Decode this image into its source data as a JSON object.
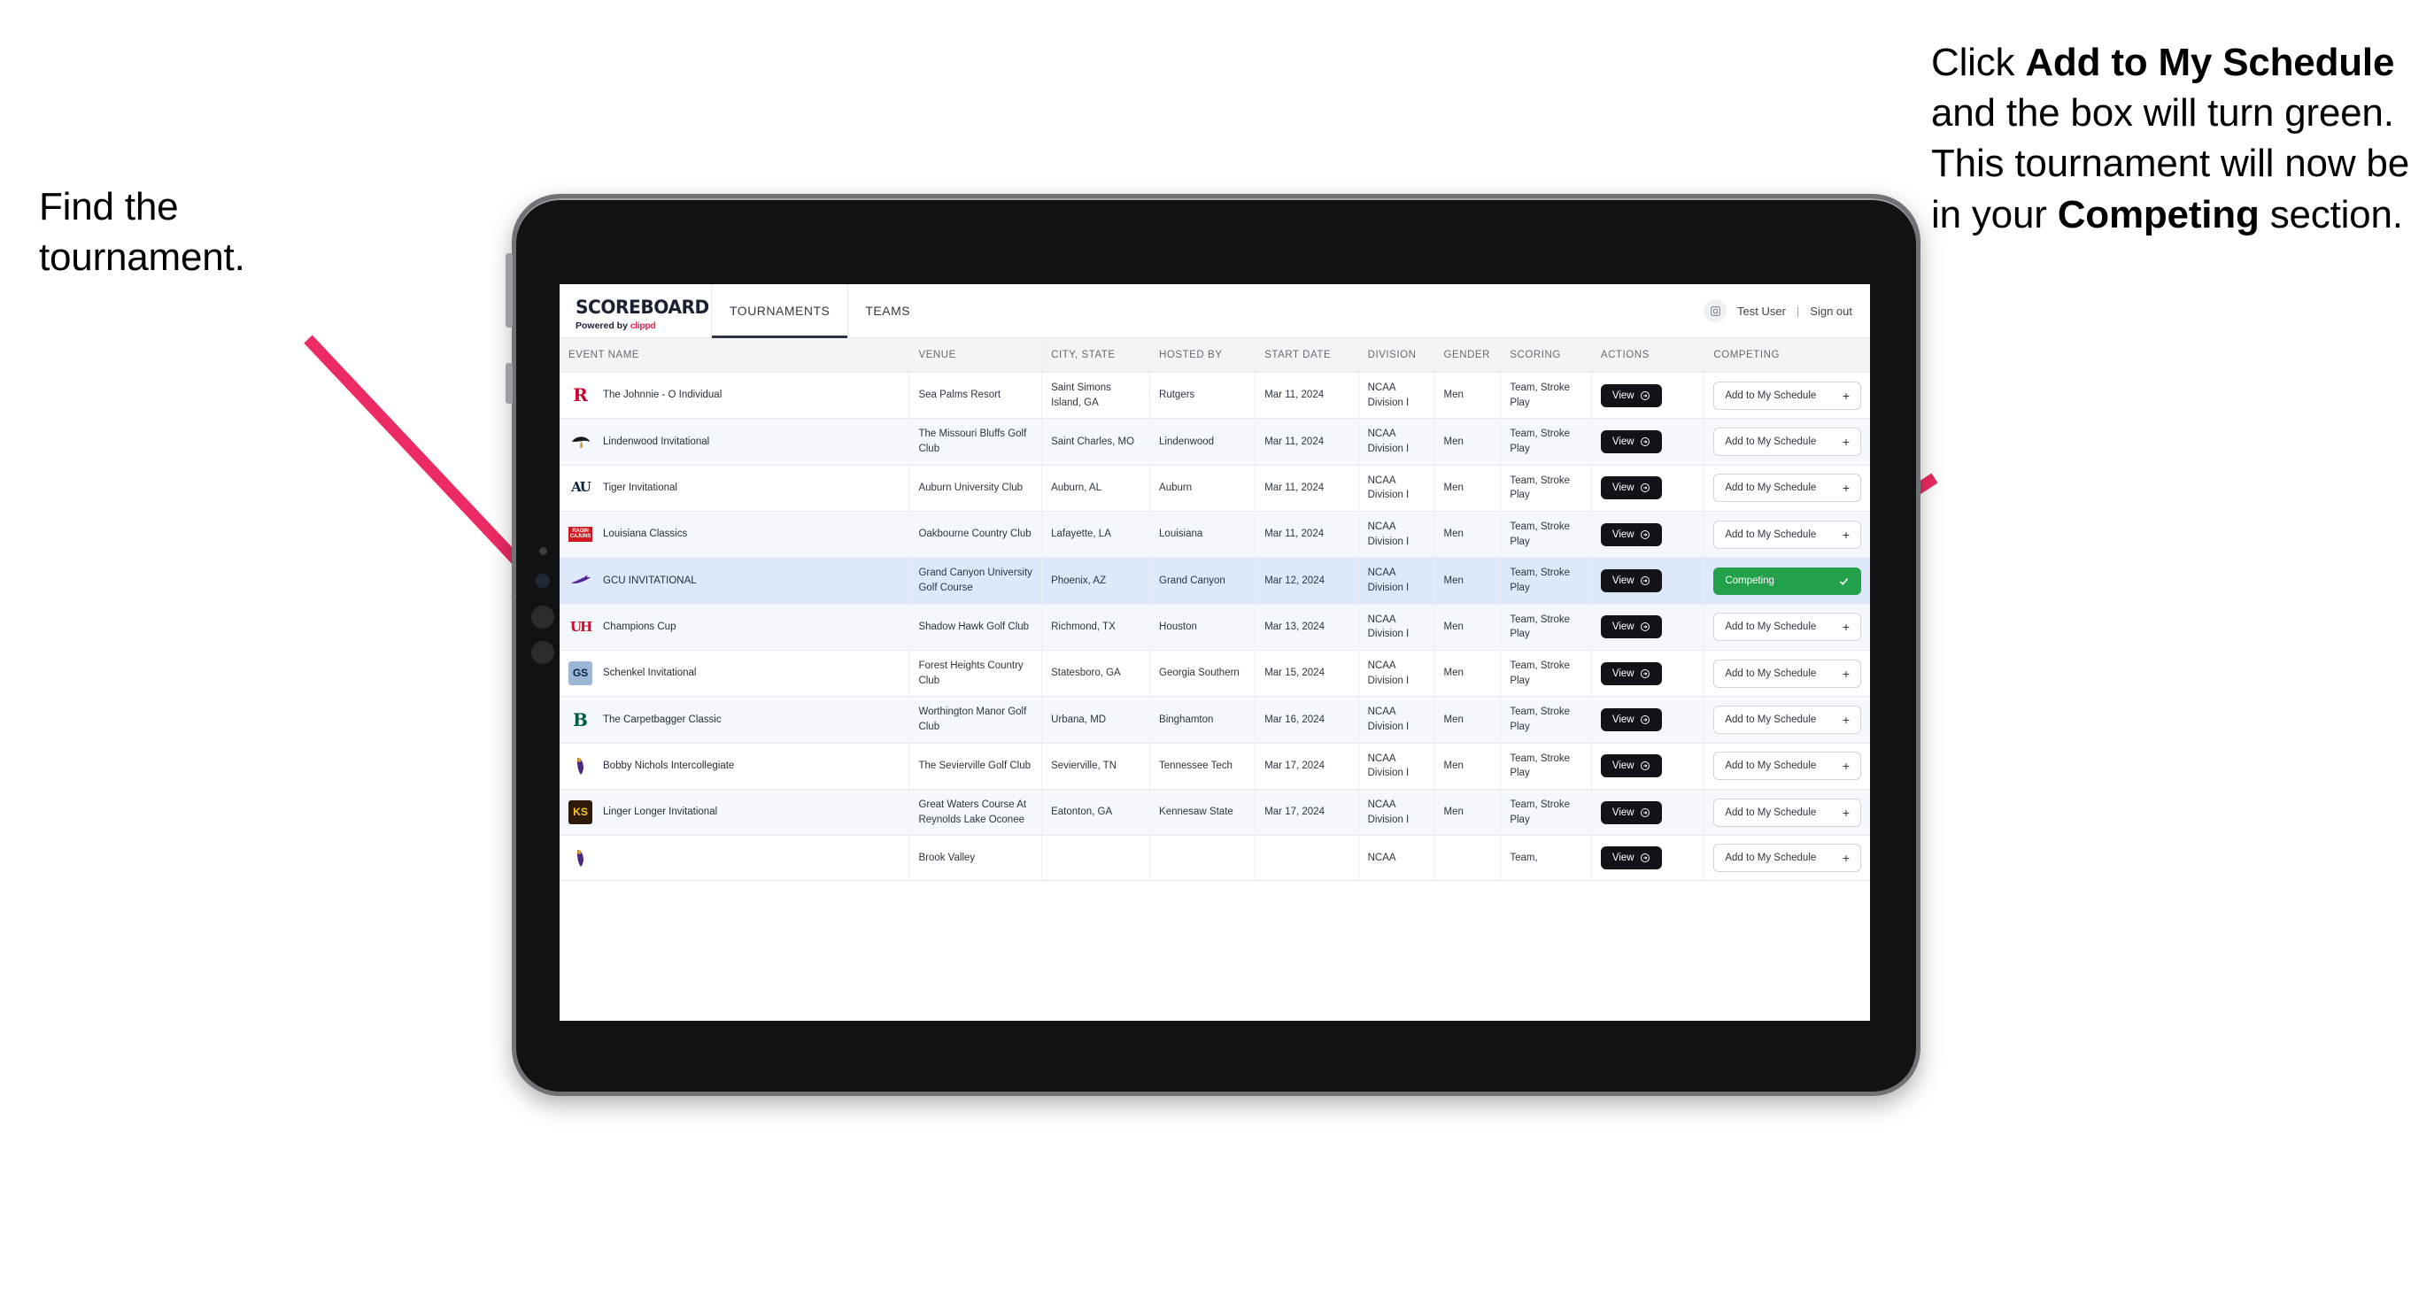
{
  "annotations": {
    "left": {
      "line1": "Find the",
      "line2": "tournament."
    },
    "right": {
      "seg1": "Click ",
      "bold1": "Add to My Schedule",
      "seg2": " and the box will turn green. This tournament will now be in your ",
      "bold2": "Competing",
      "seg3": " section."
    },
    "arrow_color": "#ec2a63"
  },
  "app": {
    "brand": {
      "title": "SCOREBOARD",
      "powered_prefix": "Powered by ",
      "powered_name": "clippd"
    },
    "tabs": [
      {
        "label": "TOURNAMENTS",
        "active": true
      },
      {
        "label": "TEAMS",
        "active": false
      }
    ],
    "user": {
      "name": "Test User",
      "separator": "|",
      "signout": "Sign out",
      "avatar_icon": "user-avatar-icon"
    },
    "table": {
      "columns": [
        "EVENT NAME",
        "VENUE",
        "CITY, STATE",
        "HOSTED BY",
        "START DATE",
        "DIVISION",
        "GENDER",
        "SCORING",
        "ACTIONS",
        "COMPETING"
      ],
      "view_label": "View",
      "add_label": "Add to My Schedule",
      "add_plus": "+",
      "competing_label": "Competing",
      "rows": [
        {
          "event": "The Johnnie - O Individual",
          "venue": "Sea Palms Resort",
          "city": "Saint Simons Island, GA",
          "host": "Rutgers",
          "date": "Mar 11, 2024",
          "division": "NCAA Division I",
          "gender": "Men",
          "scoring": "Team, Stroke Play",
          "competing": false,
          "logo": {
            "type": "letter",
            "text": "R",
            "color": "#cc0033",
            "bg": "#ffffff"
          }
        },
        {
          "event": "Lindenwood Invitational",
          "venue": "The Missouri Bluffs Golf Club",
          "city": "Saint Charles, MO",
          "host": "Lindenwood",
          "date": "Mar 11, 2024",
          "division": "NCAA Division I",
          "gender": "Men",
          "scoring": "Team, Stroke Play",
          "competing": false,
          "logo": {
            "type": "lion",
            "text": "",
            "color": "#1a1a1a",
            "bg": "#ffffff"
          }
        },
        {
          "event": "Tiger Invitational",
          "venue": "Auburn University Club",
          "city": "Auburn, AL",
          "host": "Auburn",
          "date": "Mar 11, 2024",
          "division": "NCAA Division I",
          "gender": "Men",
          "scoring": "Team, Stroke Play",
          "competing": false,
          "logo": {
            "type": "au",
            "text": "AU",
            "color": "#0c2340",
            "bg": "#ffffff"
          }
        },
        {
          "event": "Louisiana Classics",
          "venue": "Oakbourne Country Club",
          "city": "Lafayette, LA",
          "host": "Louisiana",
          "date": "Mar 11, 2024",
          "division": "NCAA Division I",
          "gender": "Men",
          "scoring": "Team, Stroke Play",
          "competing": false,
          "logo": {
            "type": "cajuns",
            "text": "RAGIN CAJUNS",
            "color": "#ce181e",
            "bg": "#ffffff"
          }
        },
        {
          "event": "GCU INVITATIONAL",
          "venue": "Grand Canyon University Golf Course",
          "city": "Phoenix, AZ",
          "host": "Grand Canyon",
          "date": "Mar 12, 2024",
          "division": "NCAA Division I",
          "gender": "Men",
          "scoring": "Team, Stroke Play",
          "competing": true,
          "logo": {
            "type": "lope",
            "text": "",
            "color": "#522398",
            "bg": "#ffffff"
          }
        },
        {
          "event": "Champions Cup",
          "venue": "Shadow Hawk Golf Club",
          "city": "Richmond, TX",
          "host": "Houston",
          "date": "Mar 13, 2024",
          "division": "NCAA Division I",
          "gender": "Men",
          "scoring": "Team, Stroke Play",
          "competing": false,
          "logo": {
            "type": "uh",
            "text": "UH",
            "color": "#c8102e",
            "bg": "#ffffff"
          }
        },
        {
          "event": "Schenkel Invitational",
          "venue": "Forest Heights Country Club",
          "city": "Statesboro, GA",
          "host": "Georgia Southern",
          "date": "Mar 15, 2024",
          "division": "NCAA Division I",
          "gender": "Men",
          "scoring": "Team, Stroke Play",
          "competing": false,
          "logo": {
            "type": "gs",
            "text": "GS",
            "color": "#00274c",
            "bg": "#9eb6d6"
          }
        },
        {
          "event": "The Carpetbagger Classic",
          "venue": "Worthington Manor Golf Club",
          "city": "Urbana, MD",
          "host": "Binghamton",
          "date": "Mar 16, 2024",
          "division": "NCAA Division I",
          "gender": "Men",
          "scoring": "Team, Stroke Play",
          "competing": false,
          "logo": {
            "type": "b",
            "text": "B",
            "color": "#005a43",
            "bg": "#ffffff"
          }
        },
        {
          "event": "Bobby Nichols Intercollegiate",
          "venue": "The Sevierville Golf Club",
          "city": "Sevierville, TN",
          "host": "Tennessee Tech",
          "date": "Mar 17, 2024",
          "division": "NCAA Division I",
          "gender": "Men",
          "scoring": "Team, Stroke Play",
          "competing": false,
          "logo": {
            "type": "eagle",
            "text": "",
            "color": "#4f2683",
            "bg": "#ffffff"
          }
        },
        {
          "event": "Linger Longer Invitational",
          "venue": "Great Waters Course At Reynolds Lake Oconee",
          "city": "Eatonton, GA",
          "host": "Kennesaw State",
          "date": "Mar 17, 2024",
          "division": "NCAA Division I",
          "gender": "Men",
          "scoring": "Team, Stroke Play",
          "competing": false,
          "logo": {
            "type": "ksu",
            "text": "KS",
            "color": "#ffc629",
            "bg": "#2d1a0a"
          }
        },
        {
          "event": "",
          "venue": "Brook Valley",
          "city": "",
          "host": "",
          "date": "",
          "division": "NCAA",
          "gender": "",
          "scoring": "Team,",
          "competing": false,
          "logo": {
            "type": "eagle",
            "text": "",
            "color": "#4f2683",
            "bg": "#ffffff"
          }
        }
      ]
    }
  }
}
